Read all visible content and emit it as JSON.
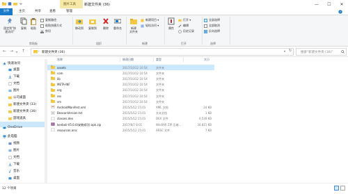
{
  "title_bar": {
    "context_tab": "图片工具",
    "window_title": "新建文件夹 (36)",
    "controls": {
      "minimize": "—",
      "maximize": "☐",
      "close": "✕"
    }
  },
  "tabs": [
    {
      "label": "文件"
    },
    {
      "label": "主页"
    },
    {
      "label": "共享"
    },
    {
      "label": "查看"
    },
    {
      "label": "管理"
    }
  ],
  "ribbon": {
    "pin": "固定到\"快\n速访问\"",
    "copy": "复制",
    "paste": "粘贴",
    "copy_path": "复制路径",
    "paste_shortcut": "粘贴快捷方式",
    "cut": "剪切",
    "group_clipboard": "剪贴板",
    "move_to": "移动到",
    "copy_to": "复制到",
    "delete": "删除",
    "rename": "重命名",
    "group_organize": "组织",
    "new_folder": "新建\n文件夹",
    "new_item": "新建项目 ▾",
    "easy_access": "轻松访问 ▾",
    "group_new": "新建",
    "properties": "属性",
    "open": "打开 ▾",
    "edit": "编辑",
    "history": "历史记录",
    "group_open": "打开",
    "select_all": "全部选择",
    "select_none": "全部取消",
    "invert_selection": "反向选择",
    "group_select": "选择"
  },
  "address": {
    "path": "新建文件夹 (36)",
    "search_placeholder": "搜索\"新建文件夹 (36)\""
  },
  "nav_pane": {
    "quick_access": "快速访问",
    "items": [
      "桌面",
      "下载",
      "文档",
      "图片",
      "公司桌面",
      "新建文件夹 (33)",
      "新建文件夹 (36)",
      "游戏道具"
    ],
    "onedrive": "OneDrive",
    "this_pc": "此电脑",
    "pc_items": [
      "视频",
      "图片",
      "文档",
      "下载",
      "音乐",
      "桌面"
    ]
  },
  "columns": {
    "name": "名称",
    "date": "修改日期",
    "type": "类型",
    "size": "大小"
  },
  "files": [
    {
      "name": "assets",
      "date": "2017/10/12 10:54",
      "type": "文件夹",
      "size": "",
      "kind": "folder"
    },
    {
      "name": "com",
      "date": "2017/10/12 10:54",
      "type": "文件夹",
      "size": "",
      "kind": "folder"
    },
    {
      "name": "lib",
      "date": "2017/10/12 10:54",
      "type": "文件夹",
      "size": "",
      "kind": "folder"
    },
    {
      "name": "META-INF",
      "date": "2017/10/12 10:54",
      "type": "文件夹",
      "size": "",
      "kind": "folder"
    },
    {
      "name": "org",
      "date": "2017/10/12 10:54",
      "type": "文件夹",
      "size": "",
      "kind": "folder"
    },
    {
      "name": "res",
      "date": "2017/10/12 10:54",
      "type": "文件夹",
      "size": "",
      "kind": "folder"
    },
    {
      "name": "sm",
      "date": "2017/10/12 10:54",
      "type": "文件夹",
      "size": "",
      "kind": "folder"
    },
    {
      "name": "AndroidManifest.xml",
      "date": "2015/5/12 15:01",
      "type": "XML 文档",
      "size": "24 KB",
      "kind": "xml"
    },
    {
      "name": "BeaconVersion.txt",
      "date": "2015/5/12 15:01",
      "type": "文本文档",
      "size": "1 KB",
      "kind": "txt"
    },
    {
      "name": "classes.dex",
      "date": "2015/5/12 15:01",
      "type": "DEX 文件",
      "size": "4,539 KB",
      "kind": "file"
    },
    {
      "name": "kenboli-V5.0.0(安装成功).apk.zip",
      "date": "2017/8/7 8:01",
      "type": "WinRAR ZIP 压缩...",
      "size": "34,811 KB",
      "kind": "zip"
    },
    {
      "name": "resources.arsc",
      "date": "2015/5/12 15:01",
      "type": "ARSC 文件",
      "size": "7 KB",
      "kind": "file"
    }
  ],
  "status": {
    "count": "12 个项目"
  },
  "colors": {
    "accent": "#1979ca",
    "selection": "#cce8ff",
    "folder": "#f4c842",
    "context_tab": "#f5e8a8"
  }
}
